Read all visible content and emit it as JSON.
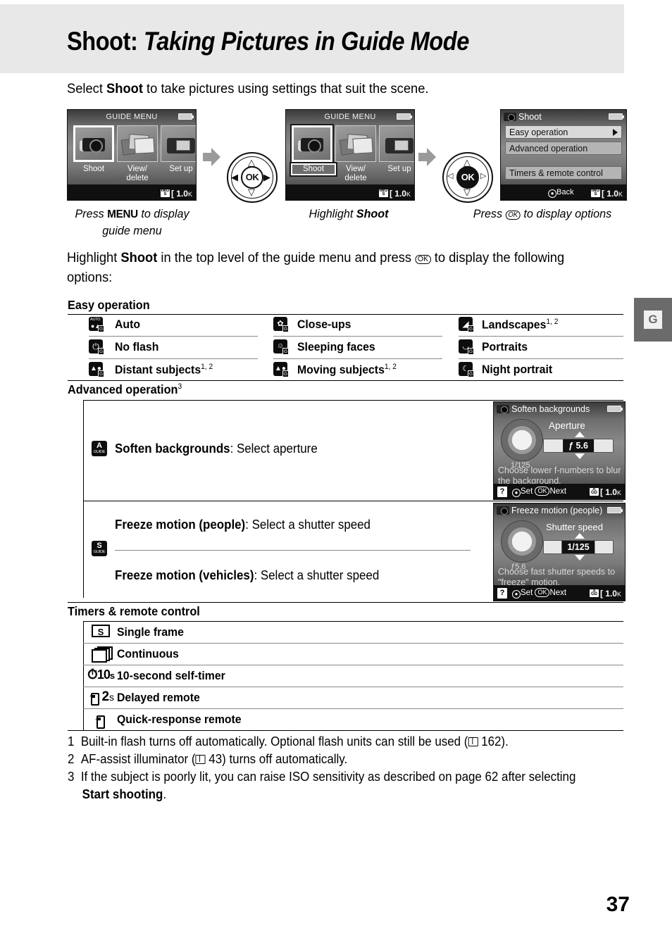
{
  "header": {
    "title_bold": "Shoot:",
    "title_italic": "Taking Pictures in Guide Mode"
  },
  "intro": {
    "before": "Select ",
    "bold": "Shoot",
    "after": " to take pictures using settings that suit the scene."
  },
  "steps": [
    {
      "screen": {
        "title": "GUIDE MENU",
        "tiles": [
          {
            "label": "Shoot",
            "selected": true
          },
          {
            "label": "View/\ndelete",
            "selected": false
          },
          {
            "label": "Set up",
            "selected": false
          }
        ],
        "footer_count": "1.0",
        "footer_unit": "K"
      },
      "caption_prefix": "Press ",
      "caption_key": "MENU",
      "caption_suffix": " to display",
      "caption_line2": "guide menu"
    },
    {
      "screen": {
        "title": "GUIDE MENU",
        "tiles": [
          {
            "label": "Shoot",
            "selected": true
          },
          {
            "label": "View/\ndelete",
            "selected": false
          },
          {
            "label": "Set up",
            "selected": false
          }
        ],
        "footer_count": "1.0",
        "footer_unit": "K"
      },
      "caption_prefix": "Highlight ",
      "caption_bold": "Shoot"
    },
    {
      "screen": {
        "title": "Shoot",
        "rows": [
          {
            "label": "Easy operation",
            "has_arrow": true,
            "dim": false
          },
          {
            "label": "Advanced operation",
            "has_arrow": false,
            "dim": true
          },
          {
            "label": "Timers & remote control",
            "has_arrow": false,
            "dim": true
          }
        ],
        "footer_back": "Back",
        "footer_count": "1.0",
        "footer_unit": "K"
      },
      "caption_prefix": "Press ",
      "caption_key": "OK",
      "caption_suffix": " to display options"
    }
  ],
  "highlight_para": {
    "p1": "Highlight ",
    "bold": "Shoot",
    "p2": " in the top level of the guide menu and press ",
    "key": "OK",
    "p3": " to display the following options:"
  },
  "easy_operation": {
    "heading": "Easy operation",
    "items": [
      {
        "label": "Auto",
        "sup": "",
        "icon": "auto-icon",
        "col": 0,
        "row": 0
      },
      {
        "label": "Close-ups",
        "sup": "",
        "icon": "close-up-icon",
        "col": 1,
        "row": 0
      },
      {
        "label": "Landscapes",
        "sup": "1, 2",
        "icon": "landscape-icon",
        "col": 2,
        "row": 0
      },
      {
        "label": "No flash",
        "sup": "",
        "icon": "no-flash-icon",
        "col": 0,
        "row": 1
      },
      {
        "label": "Sleeping faces",
        "sup": "",
        "icon": "sleeping-faces-icon",
        "col": 1,
        "row": 1
      },
      {
        "label": "Portraits",
        "sup": "",
        "icon": "portrait-icon",
        "col": 2,
        "row": 1
      },
      {
        "label": "Distant subjects",
        "sup": "1, 2",
        "icon": "distant-subjects-icon",
        "col": 0,
        "row": 2
      },
      {
        "label": "Moving subjects",
        "sup": "1, 2",
        "icon": "moving-subjects-icon",
        "col": 1,
        "row": 2
      },
      {
        "label": "Night portrait",
        "sup": "",
        "icon": "night-portrait-icon",
        "col": 2,
        "row": 2
      }
    ]
  },
  "advanced_operation": {
    "heading": "Advanced operation",
    "heading_sup": "3",
    "rows": [
      {
        "icon_big": "A",
        "icon_sub": "GUIDE",
        "bold": "Soften backgrounds",
        "rest": ": Select aperture",
        "screen": {
          "title": "Soften backgrounds",
          "param_label": "Aperture",
          "value": "ƒ 5.6",
          "dial_sub": "1/125",
          "hint": "Choose lower f-numbers to blur the background.",
          "help": "?",
          "set": "Set",
          "next": "Next",
          "footer_count": "1.0",
          "footer_unit": "K",
          "mode_badge_big": "A",
          "mode_badge_sub": "GUIDE"
        }
      },
      {
        "icon_big": "S",
        "icon_sub": "GUIDE",
        "bold": "Freeze motion (people)",
        "rest": ": Select a shutter speed",
        "bold2": "Freeze motion (vehicles)",
        "rest2": ": Select a shutter speed",
        "screen": {
          "title": "Freeze motion (people)",
          "param_label": "Shutter speed",
          "value": "1/125",
          "dial_sub": "ƒ5.6",
          "hint": "Choose fast shutter speeds to \"freeze\" motion.",
          "help": "?",
          "set": "Set",
          "next": "Next",
          "footer_count": "1.0",
          "footer_unit": "K",
          "mode_badge_big": "S",
          "mode_badge_sub": "GUIDE"
        }
      }
    ]
  },
  "timers": {
    "heading": "Timers & remote control",
    "items": [
      {
        "label": "Single frame",
        "icon": "single-frame-icon"
      },
      {
        "label": "Continuous",
        "icon": "continuous-icon"
      },
      {
        "label": "10-second self-timer",
        "icon": "self-timer-icon"
      },
      {
        "label": "Delayed remote",
        "icon": "delayed-remote-icon"
      },
      {
        "label": "Quick-response remote",
        "icon": "quick-response-remote-icon"
      }
    ]
  },
  "footnotes": [
    {
      "num": "1",
      "text_a": "Built-in flash turns off automatically.  Optional flash units can still be used (",
      "ref": "162",
      "text_b": ")."
    },
    {
      "num": "2",
      "text_a": "AF-assist illuminator (",
      "ref": "43",
      "text_b": ") turns off automatically."
    },
    {
      "num": "3",
      "text_a": "If the subject is poorly lit, you can raise ISO sensitivity as described on page 62 after selecting ",
      "bold": "Start shooting",
      "text_b": "."
    }
  ],
  "side_tab": {
    "label": "G"
  },
  "page_number": "37",
  "colors": {
    "header_band": "#e8e8e8",
    "side_tab": "#6b6b6b",
    "text": "#000000"
  }
}
